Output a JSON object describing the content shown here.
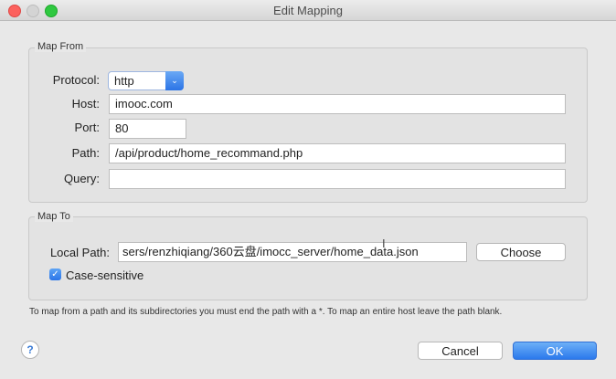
{
  "window": {
    "title": "Edit Mapping"
  },
  "map_from": {
    "legend": "Map From",
    "protocol": {
      "label": "Protocol:",
      "value": "http"
    },
    "host": {
      "label": "Host:",
      "value": "imooc.com"
    },
    "port": {
      "label": "Port:",
      "value": "80"
    },
    "path": {
      "label": "Path:",
      "value": "/api/product/home_recommand.php"
    },
    "query": {
      "label": "Query:",
      "value": ""
    }
  },
  "map_to": {
    "legend": "Map To",
    "local_path": {
      "label": "Local Path:",
      "value": "sers/renzhiqiang/360云盘/imocc_server/home_data.json"
    },
    "choose_label": "Choose",
    "case_sensitive": {
      "label": "Case-sensitive",
      "checked": true
    }
  },
  "hint": "To map from a path and its subdirectories you must end the path with a *. To map an entire host leave the path blank.",
  "footer": {
    "help": "?",
    "cancel_label": "Cancel",
    "ok_label": "OK"
  }
}
